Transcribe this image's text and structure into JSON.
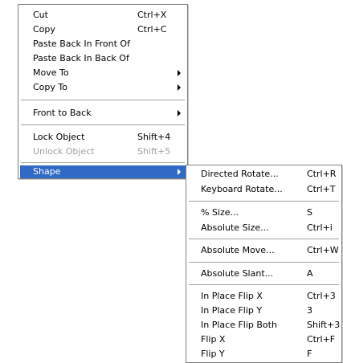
{
  "main_menu": {
    "items": [
      {
        "label": "Cut",
        "shortcut": "Ctrl+X"
      },
      {
        "label": "Copy",
        "shortcut": "Ctrl+C"
      },
      {
        "label": "Paste Back In Front Of",
        "shortcut": ""
      },
      {
        "label": "Paste Back In Back Of",
        "shortcut": ""
      },
      {
        "label": "Move To",
        "shortcut": ""
      },
      {
        "label": "Copy To",
        "shortcut": ""
      },
      {
        "label": "Front to Back",
        "shortcut": ""
      },
      {
        "label": "Lock Object",
        "shortcut": "Shift+4"
      },
      {
        "label": "Unlock Object",
        "shortcut": "Shift+5",
        "disabled": true
      },
      {
        "label": "Shape",
        "shortcut": "",
        "highlighted": true
      }
    ]
  },
  "sub_menu": {
    "items": [
      {
        "label": "Directed Rotate...",
        "shortcut": "Ctrl+R"
      },
      {
        "label": "Keyboard Rotate...",
        "shortcut": "Ctrl+T"
      },
      {
        "label": "% Size...",
        "shortcut": "S"
      },
      {
        "label": "Absolute Size...",
        "shortcut": "Ctrl+i"
      },
      {
        "label": "Absolute Move...",
        "shortcut": "Ctrl+W"
      },
      {
        "label": "Absolute Slant...",
        "shortcut": "A"
      },
      {
        "label": "In Place Flip X",
        "shortcut": "Ctrl+3"
      },
      {
        "label": "In Place Flip Y",
        "shortcut": "3"
      },
      {
        "label": "In Place Flip Both",
        "shortcut": "Shift+3"
      },
      {
        "label": "Flip X",
        "shortcut": "Ctrl+F"
      },
      {
        "label": "Flip Y",
        "shortcut": "F"
      }
    ]
  },
  "colors": {
    "highlight": "#316ac5",
    "disabled_text": "#a0a0a0",
    "border": "#7f7f7f"
  }
}
